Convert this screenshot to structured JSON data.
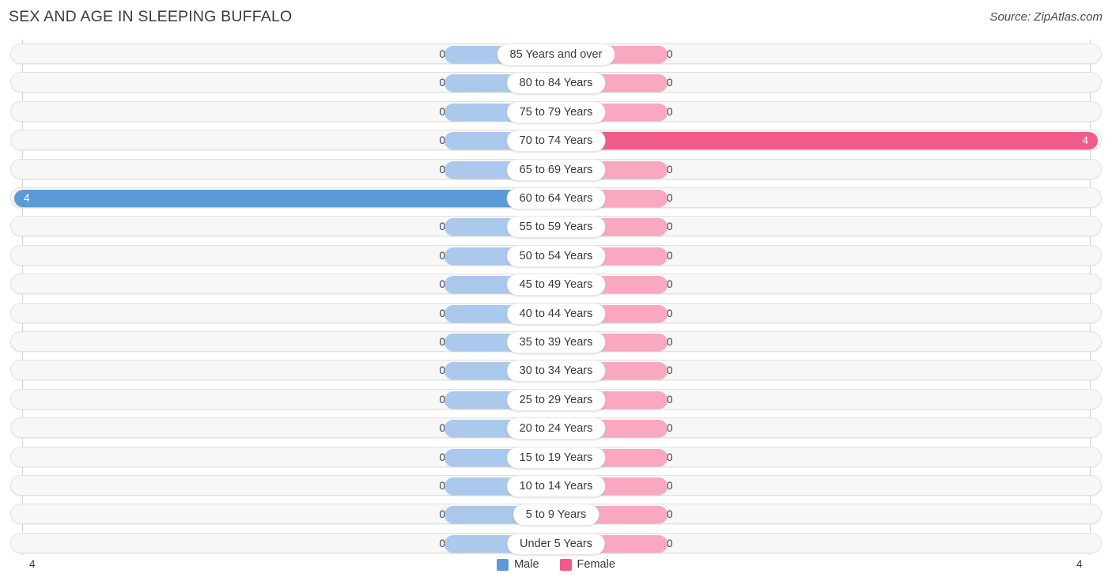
{
  "header": {
    "title": "SEX AND AGE IN SLEEPING BUFFALO",
    "source": "Source: ZipAtlas.com"
  },
  "legend": {
    "male_label": "Male",
    "female_label": "Female",
    "male_color": "#5b9bd5",
    "female_color": "#f05b89"
  },
  "axis": {
    "left_tick": "4",
    "right_tick": "4",
    "max": 4
  },
  "chart_data": {
    "type": "bar",
    "title": "SEX AND AGE IN SLEEPING BUFFALO",
    "subtitle": "Source: ZipAtlas.com",
    "xlabel": "",
    "ylabel": "",
    "orientation": "horizontal",
    "layout": "population-pyramid",
    "grid": true,
    "legend_position": "bottom-center",
    "xlim": [
      4,
      0,
      4
    ],
    "categories": [
      "85 Years and over",
      "80 to 84 Years",
      "75 to 79 Years",
      "70 to 74 Years",
      "65 to 69 Years",
      "60 to 64 Years",
      "55 to 59 Years",
      "50 to 54 Years",
      "45 to 49 Years",
      "40 to 44 Years",
      "35 to 39 Years",
      "30 to 34 Years",
      "25 to 29 Years",
      "20 to 24 Years",
      "15 to 19 Years",
      "10 to 14 Years",
      "5 to 9 Years",
      "Under 5 Years"
    ],
    "series": [
      {
        "name": "Male",
        "color": "#5b9bd5",
        "values": [
          0,
          0,
          0,
          0,
          0,
          4,
          0,
          0,
          0,
          0,
          0,
          0,
          0,
          0,
          0,
          0,
          0,
          0
        ]
      },
      {
        "name": "Female",
        "color": "#f05b89",
        "values": [
          0,
          0,
          0,
          4,
          0,
          0,
          0,
          0,
          0,
          0,
          0,
          0,
          0,
          0,
          0,
          0,
          0,
          0
        ]
      }
    ]
  },
  "rows": [
    {
      "label": "85 Years and over",
      "male": "0",
      "female": "0"
    },
    {
      "label": "80 to 84 Years",
      "male": "0",
      "female": "0"
    },
    {
      "label": "75 to 79 Years",
      "male": "0",
      "female": "0"
    },
    {
      "label": "70 to 74 Years",
      "male": "0",
      "female": "4"
    },
    {
      "label": "65 to 69 Years",
      "male": "0",
      "female": "0"
    },
    {
      "label": "60 to 64 Years",
      "male": "4",
      "female": "0"
    },
    {
      "label": "55 to 59 Years",
      "male": "0",
      "female": "0"
    },
    {
      "label": "50 to 54 Years",
      "male": "0",
      "female": "0"
    },
    {
      "label": "45 to 49 Years",
      "male": "0",
      "female": "0"
    },
    {
      "label": "40 to 44 Years",
      "male": "0",
      "female": "0"
    },
    {
      "label": "35 to 39 Years",
      "male": "0",
      "female": "0"
    },
    {
      "label": "30 to 34 Years",
      "male": "0",
      "female": "0"
    },
    {
      "label": "25 to 29 Years",
      "male": "0",
      "female": "0"
    },
    {
      "label": "20 to 24 Years",
      "male": "0",
      "female": "0"
    },
    {
      "label": "15 to 19 Years",
      "male": "0",
      "female": "0"
    },
    {
      "label": "10 to 14 Years",
      "male": "0",
      "female": "0"
    },
    {
      "label": "5 to 9 Years",
      "male": "0",
      "female": "0"
    },
    {
      "label": "Under 5 Years",
      "male": "0",
      "female": "0"
    }
  ]
}
